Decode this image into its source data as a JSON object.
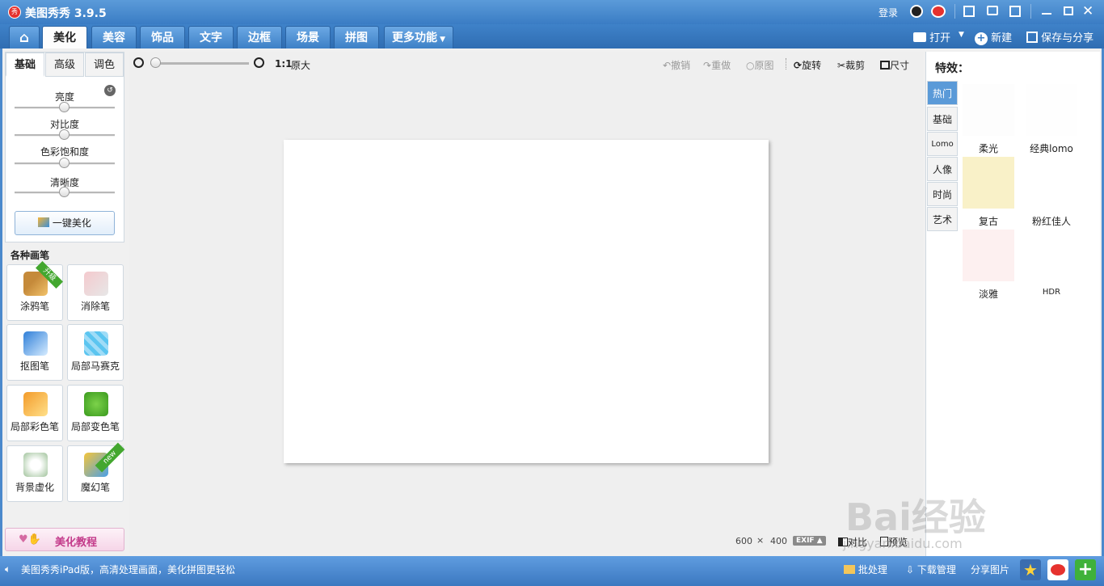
{
  "title": {
    "app": "美图秀秀 3.9.5"
  },
  "topright": {
    "login": "登录"
  },
  "tabs": {
    "home": "⌂",
    "t1": "美化",
    "t2": "美容",
    "t3": "饰品",
    "t4": "文字",
    "t5": "边框",
    "t6": "场景",
    "t7": "拼图",
    "t8": "更多功能"
  },
  "actions": {
    "open": "打开",
    "new": "新建",
    "save": "保存与分享"
  },
  "left": {
    "tab_basic": "基础",
    "tab_adv": "高级",
    "tab_color": "调色",
    "s1": "亮度",
    "s2": "对比度",
    "s3": "色彩饱和度",
    "s4": "清晰度",
    "oneclick": "一键美化",
    "brushes_title": "各种画笔",
    "b1": "涂鸦笔",
    "b2": "消除笔",
    "b3": "抠图笔",
    "b4": "局部马赛克",
    "b5": "局部彩色笔",
    "b6": "局部变色笔",
    "b7": "背景虚化",
    "b8": "魔幻笔",
    "badge_up": "升级",
    "badge_new": "new",
    "tutorial": "美化教程"
  },
  "toolbar": {
    "ratio": "1:1",
    "orig_size": "原大",
    "undo": "撤销",
    "redo": "重做",
    "original": "原图",
    "rotate": "旋转",
    "crop": "裁剪",
    "size": "尺寸"
  },
  "canvas": {
    "w": "600",
    "x": "×",
    "h": "400",
    "exif": "EXIF",
    "compare": "对比",
    "preview": "预览"
  },
  "right": {
    "title": "特效：",
    "v1": "热门",
    "v2": "基础",
    "v3": "Lomo",
    "v4": "人像",
    "v5": "时尚",
    "v6": "艺术",
    "e1": "柔光",
    "e2": "经典lomo",
    "e3": "复古",
    "e4": "粉红佳人",
    "e5": "淡雅",
    "e6": "HDR"
  },
  "status": {
    "promo": "美图秀秀iPad版，高清处理画面，美化拼图更轻松",
    "batch": "批处理",
    "download": "下载管理",
    "share": "分享图片"
  },
  "watermark": {
    "text": "Bai经验",
    "url": "jingyan.baidu.com"
  },
  "colors": {
    "accent": "#3a7cc4",
    "effect_fugu": "#f9f1c8",
    "effect_danya": "#fdf0f0"
  }
}
